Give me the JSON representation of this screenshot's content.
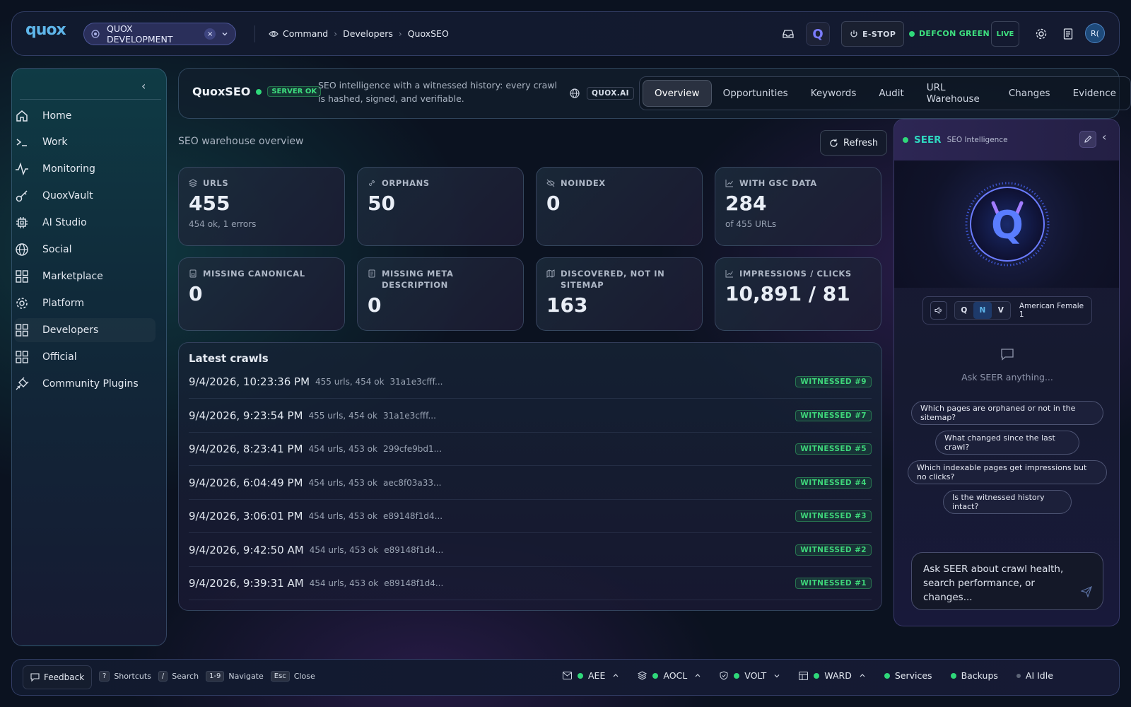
{
  "topbar": {
    "logo": "quox",
    "workspace": "QUOX DEVELOPMENT",
    "workspace_clear": "×",
    "breadcrumb": [
      "Command",
      "Developers",
      "QuoxSEO"
    ],
    "estop": "E-STOP",
    "defcon": "DEFCON GREEN",
    "live": "LIVE",
    "avatar": "R("
  },
  "sidebar": {
    "items": [
      {
        "label": "Home",
        "icon": "home-icon"
      },
      {
        "label": "Work",
        "icon": "terminal-icon"
      },
      {
        "label": "Monitoring",
        "icon": "activity-icon"
      },
      {
        "label": "QuoxVault",
        "icon": "key-icon"
      },
      {
        "label": "AI Studio",
        "icon": "chip-icon"
      },
      {
        "label": "Social",
        "icon": "globe-icon"
      },
      {
        "label": "Marketplace",
        "icon": "grid-icon"
      },
      {
        "label": "Platform",
        "icon": "gear-icon"
      },
      {
        "label": "Developers",
        "icon": "grid-icon"
      },
      {
        "label": "Official",
        "icon": "grid-icon"
      },
      {
        "label": "Community Plugins",
        "icon": "plug-icon"
      }
    ],
    "active_index": 8
  },
  "header": {
    "title": "QuoxSEO",
    "status": "SERVER OK",
    "description": "SEO intelligence with a witnessed history: every crawl is hashed, signed, and verifiable.",
    "domain": "QUOX.AI",
    "tabs": [
      "Overview",
      "Opportunities",
      "Keywords",
      "Audit",
      "URL Warehouse",
      "Changes",
      "Evidence"
    ],
    "active_tab": 0
  },
  "main": {
    "subtitle": "SEO warehouse overview",
    "refresh": "Refresh",
    "stats": [
      {
        "label": "URLS",
        "value": "455",
        "sub": "454 ok, 1 errors",
        "icon": "layers-icon"
      },
      {
        "label": "ORPHANS",
        "value": "50",
        "sub": "",
        "icon": "link-icon"
      },
      {
        "label": "NOINDEX",
        "value": "0",
        "sub": "",
        "icon": "eye-off-icon"
      },
      {
        "label": "WITH GSC DATA",
        "value": "284",
        "sub": "of 455 URLs",
        "icon": "chart-icon"
      },
      {
        "label": "MISSING CANONICAL",
        "value": "0",
        "sub": "",
        "icon": "file-icon"
      },
      {
        "label": "MISSING META DESCRIPTION",
        "value": "0",
        "sub": "",
        "icon": "file-text-icon"
      },
      {
        "label": "DISCOVERED, NOT IN SITEMAP",
        "value": "163",
        "sub": "",
        "icon": "map-icon"
      },
      {
        "label": "IMPRESSIONS / CLICKS",
        "value": "10,891 / 81",
        "sub": "",
        "icon": "chart-icon"
      }
    ],
    "crawls_title": "Latest crawls",
    "crawls": [
      {
        "date": "9/4/2026, 10:23:36 PM",
        "meta": "455 urls, 454 ok",
        "hash": "31a1e3cfff...",
        "badge": "WITNESSED #9"
      },
      {
        "date": "9/4/2026, 9:23:54 PM",
        "meta": "455 urls, 454 ok",
        "hash": "31a1e3cfff...",
        "badge": "WITNESSED #7"
      },
      {
        "date": "9/4/2026, 8:23:41 PM",
        "meta": "454 urls, 453 ok",
        "hash": "299cfe9bd1...",
        "badge": "WITNESSED #5"
      },
      {
        "date": "9/4/2026, 6:04:49 PM",
        "meta": "454 urls, 453 ok",
        "hash": "aec8f03a33...",
        "badge": "WITNESSED #4"
      },
      {
        "date": "9/4/2026, 3:06:01 PM",
        "meta": "454 urls, 453 ok",
        "hash": "e89148f1d4...",
        "badge": "WITNESSED #3"
      },
      {
        "date": "9/4/2026, 9:42:50 AM",
        "meta": "454 urls, 453 ok",
        "hash": "e89148f1d4...",
        "badge": "WITNESSED #2"
      },
      {
        "date": "9/4/2026, 9:39:31 AM",
        "meta": "454 urls, 453 ok",
        "hash": "e89148f1d4...",
        "badge": "WITNESSED #1"
      }
    ]
  },
  "seer": {
    "title": "SEER",
    "subtitle": "SEO Intelligence",
    "voice_modes": [
      "Q",
      "N",
      "V"
    ],
    "active_mode": 1,
    "voice": "American Female 1",
    "prompt": "Ask SEER anything...",
    "suggestions": [
      "Which pages are orphaned or not in the sitemap?",
      "What changed since the last crawl?",
      "Which indexable pages get impressions but no clicks?",
      "Is the witnessed history intact?"
    ],
    "input_placeholder": "Ask SEER about crawl health, search performance, or changes..."
  },
  "bottom": {
    "feedback": "Feedback",
    "shortcuts": [
      {
        "key": "?",
        "label": "Shortcuts"
      },
      {
        "key": "/",
        "label": "Search"
      },
      {
        "key": "1-9",
        "label": "Navigate"
      },
      {
        "key": "Esc",
        "label": "Close"
      }
    ],
    "status": [
      "AEE",
      "AOCL",
      "VOLT",
      "WARD"
    ],
    "services": [
      "Services",
      "Backups",
      "AI Idle"
    ]
  },
  "colors": {
    "accent": "#5fb6ea",
    "ok": "#2fd87a",
    "seer": "#7b7cff"
  }
}
